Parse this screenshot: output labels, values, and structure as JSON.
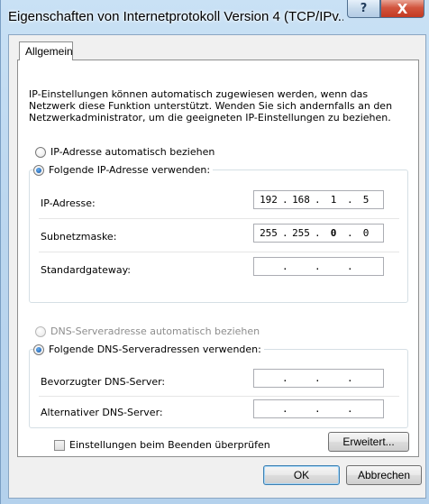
{
  "window": {
    "title": "Eigenschaften von Internetprotokoll Version 4 (TCP/IPv...",
    "help_glyph": "?",
    "close_glyph": "X"
  },
  "tabs": [
    {
      "label": "Allgemein",
      "selected": true
    }
  ],
  "description": "IP-Einstellungen können automatisch zugewiesen werden, wenn das Netzwerk diese Funktion unterstützt. Wenden Sie sich andernfalls an den Netzwerkadministrator, um die geeigneten IP-Einstellungen zu beziehen.",
  "ip_section": {
    "auto_radio": {
      "label": "IP-Adresse automatisch beziehen",
      "checked": false
    },
    "manual_radio": {
      "label": "Folgende IP-Adresse verwenden:",
      "checked": true
    },
    "fields": [
      {
        "label": "IP-Adresse:",
        "octets": [
          "192",
          "168",
          "1",
          "5"
        ]
      },
      {
        "label": "Subnetzmaske:",
        "octets": [
          "255",
          "255",
          "0",
          "0"
        ]
      },
      {
        "label": "Standardgateway:",
        "octets": [
          "",
          "",
          "",
          ""
        ]
      }
    ]
  },
  "dns_section": {
    "auto_radio": {
      "label": "DNS-Serveradresse automatisch beziehen",
      "checked": false,
      "disabled": true
    },
    "manual_radio": {
      "label": "Folgende DNS-Serveradressen verwenden:",
      "checked": true
    },
    "fields": [
      {
        "label": "Bevorzugter DNS-Server:",
        "octets": [
          "",
          "",
          "",
          ""
        ]
      },
      {
        "label": "Alternativer DNS-Server:",
        "octets": [
          "",
          "",
          "",
          ""
        ]
      }
    ]
  },
  "validate_checkbox": {
    "label": "Einstellungen beim Beenden überprüfen",
    "checked": false
  },
  "buttons": {
    "advanced": "Erweitert...",
    "ok": "OK",
    "cancel": "Abbrechen"
  },
  "ip_dot": "."
}
